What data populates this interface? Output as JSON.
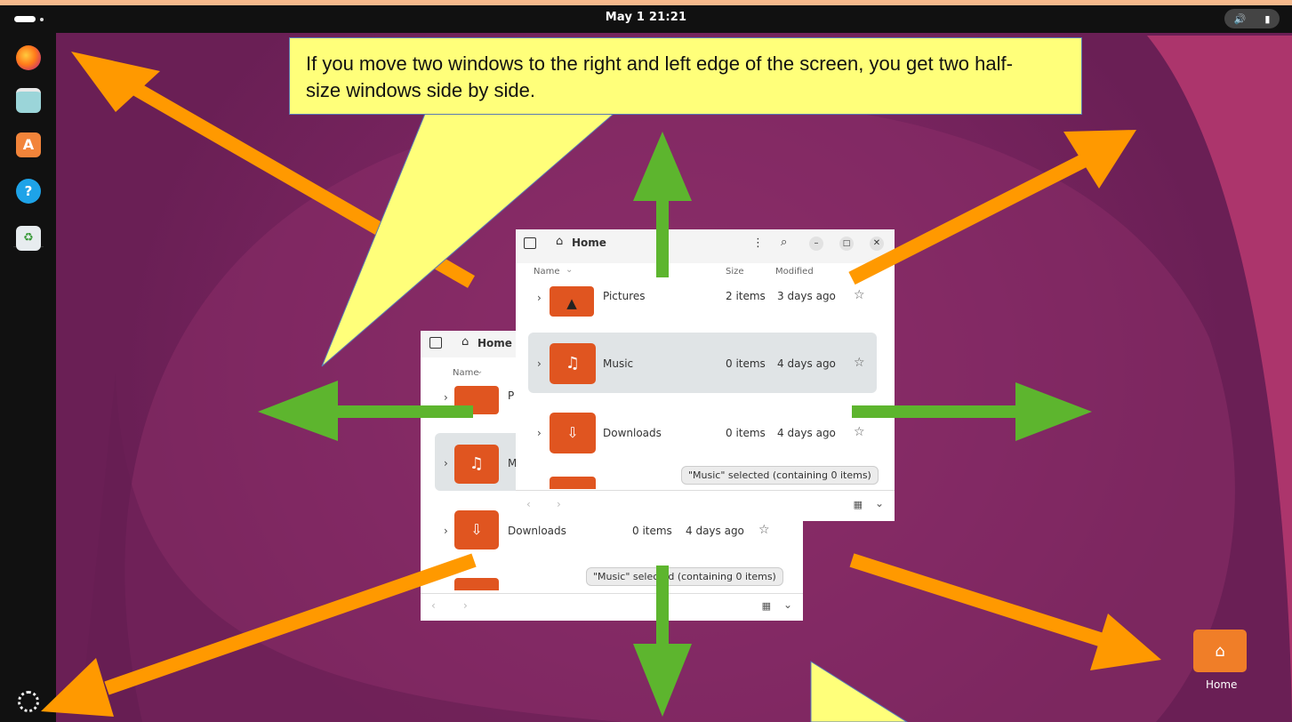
{
  "topbar": {
    "clock": "May 1  21:21",
    "tray_icons": [
      "volume-icon",
      "battery-icon"
    ]
  },
  "dock": {
    "items": [
      {
        "name": "firefox",
        "icon": "firefox-icon"
      },
      {
        "name": "files",
        "icon": "files-icon"
      },
      {
        "name": "app-center",
        "icon": "app-center-icon"
      },
      {
        "name": "help",
        "icon": "help-icon"
      },
      {
        "name": "trash",
        "icon": "trash-icon"
      }
    ],
    "apps_grid_icon": "ubuntu-apps-icon"
  },
  "callout": {
    "text": "If you move two windows to the right and left edge of the screen, you get two half-size windows side by side."
  },
  "window_front": {
    "title": "Home",
    "columns": {
      "name": "Name",
      "size": "Size",
      "modified": "Modified"
    },
    "rows": [
      {
        "name": "Pictures",
        "items": "2 items",
        "modified": "3 days ago"
      },
      {
        "name": "Music",
        "items": "0 items",
        "modified": "4 days ago",
        "selected": true
      },
      {
        "name": "Downloads",
        "items": "0 items",
        "modified": "4 days ago"
      }
    ],
    "status": "\"Music\" selected  (containing 0 items)"
  },
  "window_back": {
    "title": "Home",
    "columns": {
      "name": "Name"
    },
    "rows": [
      {
        "name": "P"
      },
      {
        "name": "M"
      },
      {
        "name": "Downloads",
        "items": "0 items",
        "modified": "4 days ago"
      }
    ],
    "status": "\"Music\" selected  (containing 0 items)"
  },
  "desktop": {
    "home_label": "Home"
  },
  "colors": {
    "orange_arrow": "#ff9900",
    "green_arrow": "#5db52e",
    "callout_fill": "#ffff7a",
    "folder_orange": "#e05520",
    "desktop_bg": "#7a2560"
  }
}
